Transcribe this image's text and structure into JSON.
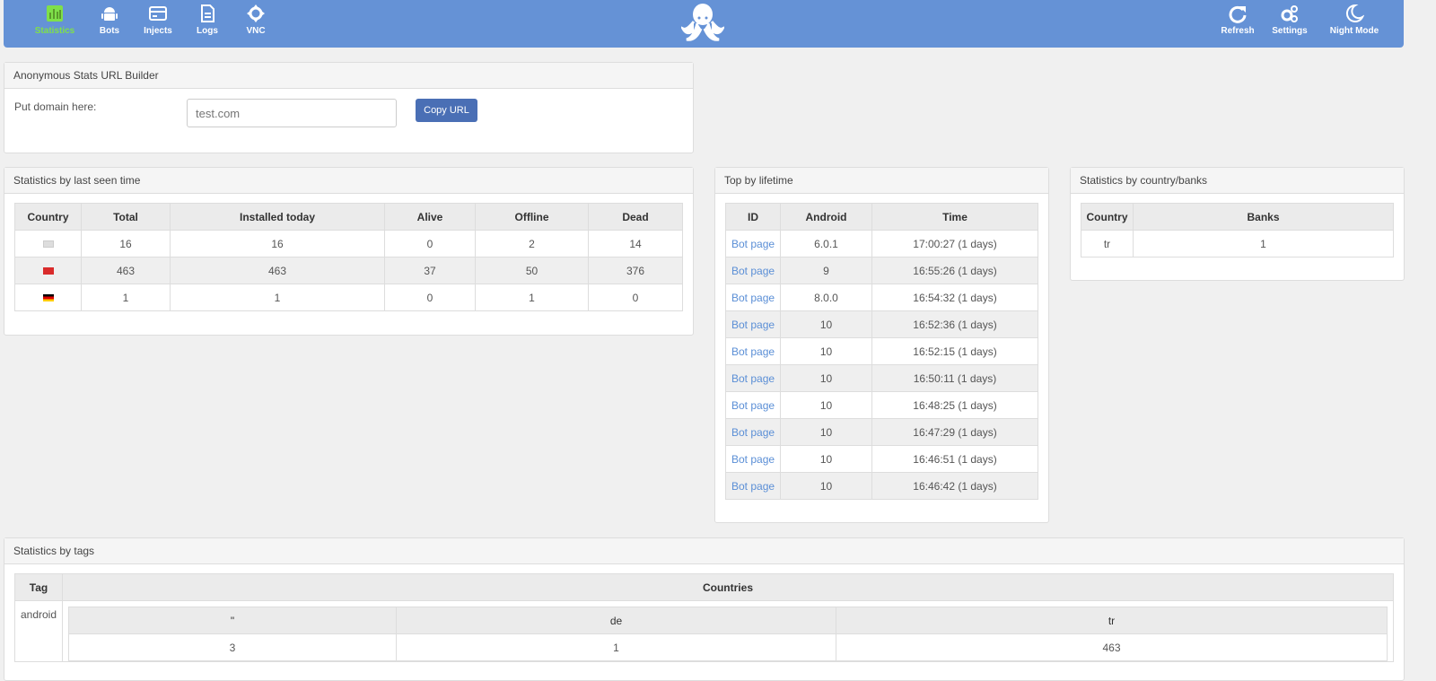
{
  "nav": {
    "left": [
      {
        "label": "Statistics",
        "icon": "chart-icon",
        "active": true
      },
      {
        "label": "Bots",
        "icon": "android-icon"
      },
      {
        "label": "Injects",
        "icon": "card-icon"
      },
      {
        "label": "Logs",
        "icon": "document-icon"
      },
      {
        "label": "VNC",
        "icon": "crosshair-icon"
      }
    ],
    "right": [
      {
        "label": "Refresh",
        "icon": "refresh-icon"
      },
      {
        "label": "Settings",
        "icon": "gears-icon"
      },
      {
        "label": "Night Mode",
        "icon": "moon-icon"
      }
    ]
  },
  "url_builder": {
    "title": "Anonymous Stats URL Builder",
    "label": "Put domain here:",
    "placeholder": "test.com",
    "button": "Copy URL"
  },
  "last_seen": {
    "title": "Statistics by last seen time",
    "headers": [
      "Country",
      "Total",
      "Installed today",
      "Alive",
      "Offline",
      "Dead"
    ],
    "rows": [
      {
        "flag": "unknown",
        "cells": [
          "16",
          "16",
          "0",
          "2",
          "14"
        ]
      },
      {
        "flag": "tr",
        "cells": [
          "463",
          "463",
          "37",
          "50",
          "376"
        ]
      },
      {
        "flag": "de",
        "cells": [
          "1",
          "1",
          "0",
          "1",
          "0"
        ]
      }
    ]
  },
  "lifetime": {
    "title": "Top by lifetime",
    "headers": [
      "ID",
      "Android",
      "Time"
    ],
    "rows": [
      [
        "Bot page",
        "6.0.1",
        "17:00:27 (1 days)"
      ],
      [
        "Bot page",
        "9",
        "16:55:26 (1 days)"
      ],
      [
        "Bot page",
        "8.0.0",
        "16:54:32 (1 days)"
      ],
      [
        "Bot page",
        "10",
        "16:52:36 (1 days)"
      ],
      [
        "Bot page",
        "10",
        "16:52:15 (1 days)"
      ],
      [
        "Bot page",
        "10",
        "16:50:11 (1 days)"
      ],
      [
        "Bot page",
        "10",
        "16:48:25 (1 days)"
      ],
      [
        "Bot page",
        "10",
        "16:47:29 (1 days)"
      ],
      [
        "Bot page",
        "10",
        "16:46:51 (1 days)"
      ],
      [
        "Bot page",
        "10",
        "16:46:42 (1 days)"
      ]
    ]
  },
  "banks": {
    "title": "Statistics by country/banks",
    "headers": [
      "Country",
      "Banks"
    ],
    "rows": [
      [
        "tr",
        "1"
      ]
    ]
  },
  "tags": {
    "title": "Statistics by tags",
    "headers": [
      "Tag",
      "Countries"
    ],
    "tag": "android",
    "sub_headers": [
      "\"",
      "de",
      "tr"
    ],
    "sub_values": [
      "3",
      "1",
      "463"
    ]
  }
}
